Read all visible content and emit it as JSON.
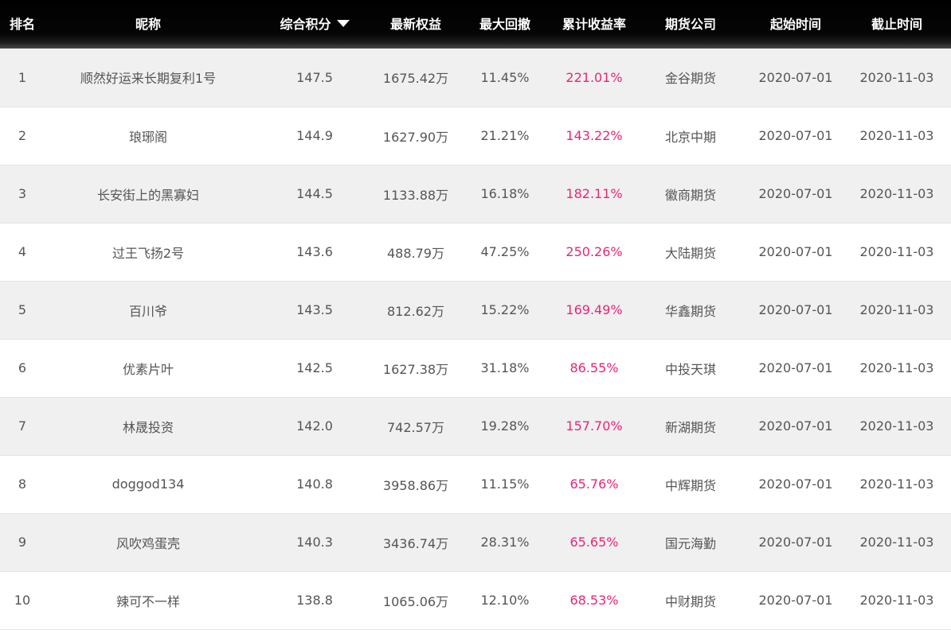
{
  "header": {
    "rank": "排名",
    "nickname": "昵称",
    "score": "综合积分",
    "equity": "最新权益",
    "drawdown": "最大回撤",
    "return": "累计收益率",
    "company": "期货公司",
    "start": "起始时间",
    "end": "截止时间"
  },
  "sort": {
    "column": "综合积分",
    "direction": "descending",
    "icon": "caret-down-icon"
  },
  "colors": {
    "return_text": "#e4277a",
    "header_bg": "#000000",
    "row_alt": "#f0f0f0"
  },
  "rows": [
    {
      "rank": "1",
      "nickname": "顺然好运来长期复利1号",
      "score": "147.5",
      "equity": "1675.42万",
      "drawdown": "11.45%",
      "return": "221.01%",
      "company": "金谷期货",
      "start": "2020-07-01",
      "end": "2020-11-03"
    },
    {
      "rank": "2",
      "nickname": "琅琊阁",
      "score": "144.9",
      "equity": "1627.90万",
      "drawdown": "21.21%",
      "return": "143.22%",
      "company": "北京中期",
      "start": "2020-07-01",
      "end": "2020-11-03"
    },
    {
      "rank": "3",
      "nickname": "长安街上的黑寡妇",
      "score": "144.5",
      "equity": "1133.88万",
      "drawdown": "16.18%",
      "return": "182.11%",
      "company": "徽商期货",
      "start": "2020-07-01",
      "end": "2020-11-03"
    },
    {
      "rank": "4",
      "nickname": "过王飞扬2号",
      "score": "143.6",
      "equity": "488.79万",
      "drawdown": "47.25%",
      "return": "250.26%",
      "company": "大陆期货",
      "start": "2020-07-01",
      "end": "2020-11-03"
    },
    {
      "rank": "5",
      "nickname": "百川爷",
      "score": "143.5",
      "equity": "812.62万",
      "drawdown": "15.22%",
      "return": "169.49%",
      "company": "华鑫期货",
      "start": "2020-07-01",
      "end": "2020-11-03"
    },
    {
      "rank": "6",
      "nickname": "优素片叶",
      "score": "142.5",
      "equity": "1627.38万",
      "drawdown": "31.18%",
      "return": "86.55%",
      "company": "中投天琪",
      "start": "2020-07-01",
      "end": "2020-11-03"
    },
    {
      "rank": "7",
      "nickname": "林晟投资",
      "score": "142.0",
      "equity": "742.57万",
      "drawdown": "19.28%",
      "return": "157.70%",
      "company": "新湖期货",
      "start": "2020-07-01",
      "end": "2020-11-03"
    },
    {
      "rank": "8",
      "nickname": "doggod134",
      "score": "140.8",
      "equity": "3958.86万",
      "drawdown": "11.15%",
      "return": "65.76%",
      "company": "中辉期货",
      "start": "2020-07-01",
      "end": "2020-11-03"
    },
    {
      "rank": "9",
      "nickname": "风吹鸡蛋壳",
      "score": "140.3",
      "equity": "3436.74万",
      "drawdown": "28.31%",
      "return": "65.65%",
      "company": "国元海勤",
      "start": "2020-07-01",
      "end": "2020-11-03"
    },
    {
      "rank": "10",
      "nickname": "辣可不一样",
      "score": "138.8",
      "equity": "1065.06万",
      "drawdown": "12.10%",
      "return": "68.53%",
      "company": "中财期货",
      "start": "2020-07-01",
      "end": "2020-11-03"
    }
  ]
}
